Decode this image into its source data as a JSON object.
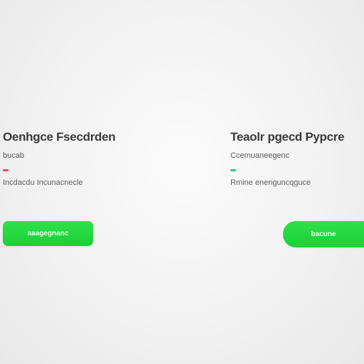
{
  "panels": {
    "left": {
      "title": "Oenhgce Fsecdrden",
      "subtitle": "bucab",
      "status_color": "#e84a4a",
      "description": "Incdacdu Incunacnecle",
      "button_label": "aaagegnanc"
    },
    "right": {
      "title": "Teaolr pgecd Pypcre",
      "subtitle": "Ccemuaneegenc",
      "status_color": "#2ecc71",
      "description": "Rmine enenguncqguce",
      "button_label": "bacune"
    }
  },
  "colors": {
    "button_green": "#22d63e"
  }
}
